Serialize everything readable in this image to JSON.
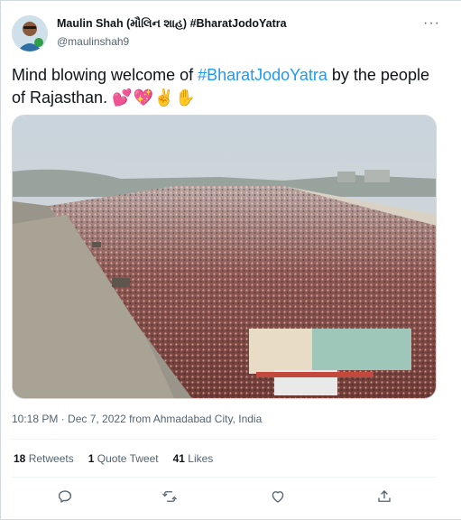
{
  "author": {
    "display_name": "Maulin Shah (મૌલિન શાહ) #BharatJodoYatra",
    "handle": "@maulinshah9"
  },
  "tweet": {
    "text_prefix": "Mind blowing welcome of ",
    "hashtag": "#BharatJodoYatra",
    "text_suffix": " by the people of Rajasthan. ",
    "emojis": "💕💖✌️✋"
  },
  "meta": {
    "timestamp": "10:18 PM · Dec 7, 2022 from Ahmadabad City, India"
  },
  "stats": {
    "retweets_count": "18",
    "retweets_label": "Retweets",
    "quotes_count": "1",
    "quotes_label": "Quote Tweet",
    "likes_count": "41",
    "likes_label": "Likes"
  },
  "actions": {
    "icons": [
      "reply-icon",
      "retweet-icon",
      "like-icon",
      "share-icon"
    ]
  },
  "colors": {
    "link": "#1d9bf0",
    "secondary_text": "#536471",
    "border": "#cfd9de"
  }
}
